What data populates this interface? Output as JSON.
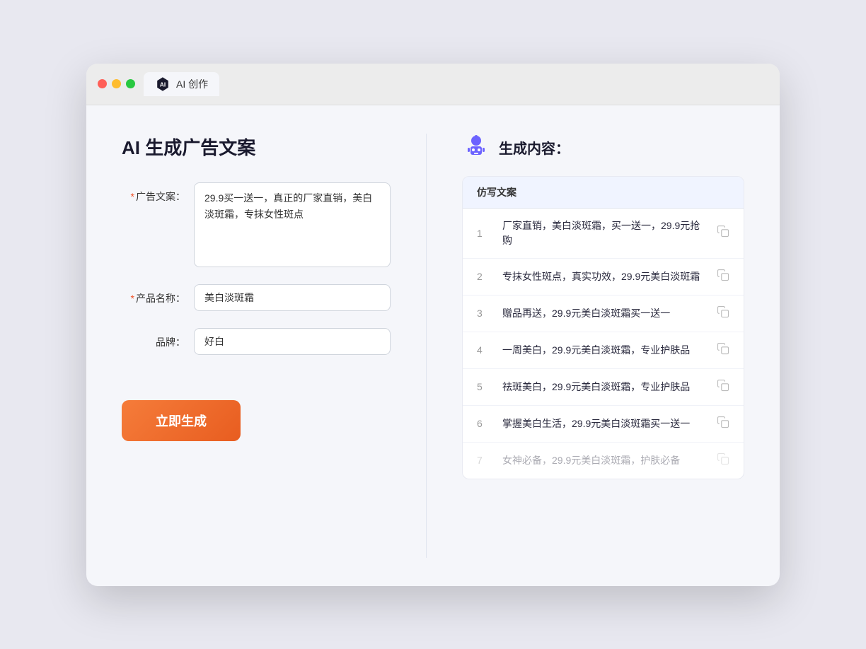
{
  "tab": {
    "label": "AI 创作"
  },
  "left": {
    "title": "AI 生成广告文案",
    "fields": [
      {
        "id": "ad-copy",
        "label": "广告文案：",
        "required": true,
        "type": "textarea",
        "value": "29.9买一送一，真正的厂家直销，美白淡斑霜，专抹女性斑点"
      },
      {
        "id": "product-name",
        "label": "产品名称：",
        "required": true,
        "type": "input",
        "value": "美白淡斑霜"
      },
      {
        "id": "brand",
        "label": "品牌：",
        "required": false,
        "type": "input",
        "value": "好白"
      }
    ],
    "generate_button": "立即生成"
  },
  "right": {
    "title": "生成内容：",
    "table_header": "仿写文案",
    "results": [
      {
        "index": 1,
        "text": "厂家直销，美白淡斑霜，买一送一，29.9元抢购",
        "faded": false
      },
      {
        "index": 2,
        "text": "专抹女性斑点，真实功效，29.9元美白淡斑霜",
        "faded": false
      },
      {
        "index": 3,
        "text": "赠品再送，29.9元美白淡斑霜买一送一",
        "faded": false
      },
      {
        "index": 4,
        "text": "一周美白，29.9元美白淡斑霜，专业护肤品",
        "faded": false
      },
      {
        "index": 5,
        "text": "祛斑美白，29.9元美白淡斑霜，专业护肤品",
        "faded": false
      },
      {
        "index": 6,
        "text": "掌握美白生活，29.9元美白淡斑霜买一送一",
        "faded": false
      },
      {
        "index": 7,
        "text": "女神必备，29.9元美白淡斑霜，护肤必备",
        "faded": true
      }
    ]
  },
  "traffic_lights": {
    "red": "red",
    "yellow": "yellow",
    "green": "green"
  }
}
